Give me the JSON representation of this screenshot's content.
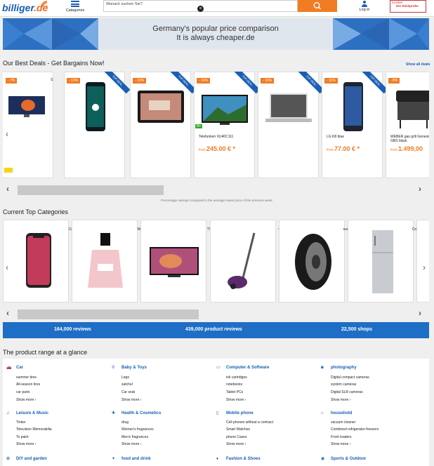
{
  "header": {
    "logo_main": "billiger",
    "logo_tld": ".de",
    "categories_label": "Categories",
    "search_placeholder": "Wonach suchen Sie?",
    "login_label": "Log in",
    "badge_top": "Kunden",
    "badge_main": "Die Stichprobe"
  },
  "banner": {
    "line1": "Germany's popular price comparison",
    "line2": "It is always cheaper.de"
  },
  "deals": {
    "title": "Our Best Deals - Get Bargains Now!",
    "show_all": "Show all deals",
    "ribbon": "TOP DEAL",
    "note": "Percentage savings compared to the average lowest price of the previous week.",
    "items": [
      {
        "discount": "- 7%",
        "name": "",
        "from": "",
        "price": ""
      },
      {
        "discount": "- 13%",
        "name": "",
        "from": "",
        "price": ""
      },
      {
        "discount": "- 13%",
        "name": "",
        "from": "",
        "price": ""
      },
      {
        "discount": "- 14%",
        "name": "Telefunken XU40C111",
        "from": "from",
        "price": "245.00 € *"
      },
      {
        "discount": "- 10%",
        "name": "",
        "from": "",
        "price": ""
      },
      {
        "discount": "- 11%",
        "name": "LG K8 blue",
        "from": "from",
        "price": "77.00 € *"
      },
      {
        "discount": "- 8%",
        "name": "WEBER gas grill Genesis II E-410 GBS black",
        "from": "from",
        "price": "1.499,00"
      }
    ],
    "rating": "A+",
    "side_letters": [
      "S",
      "u"
    ]
  },
  "categories": {
    "title": "Current Top Categories",
    "labels": [
      "Cel",
      "Wo",
      "TV",
      "vac",
      "sum",
      "Con"
    ]
  },
  "stats": {
    "reviews": "164,000 reviews",
    "product_reviews": "439,000 product reviews",
    "shops": "22,500 shops"
  },
  "range": {
    "title": "The product range at a glance",
    "groups": [
      {
        "title": "Car",
        "icon": "car-icon",
        "items": [
          "summer tires",
          "All-season tires",
          "car parts"
        ],
        "more": "Show more"
      },
      {
        "title": "Baby & Toys",
        "icon": "baby-icon",
        "items": [
          "Lego",
          "satchel",
          "Car seat"
        ],
        "more": "Show more"
      },
      {
        "title": "Computer & Software",
        "icon": "computer-icon",
        "items": [
          "ink cartridges",
          "notebooks",
          "Tablet PCs"
        ],
        "more": "Show more"
      },
      {
        "title": "photography",
        "icon": "camera-icon",
        "items": [
          "Digital compact cameras",
          "system cameras",
          "Digital SLR cameras"
        ],
        "more": "Show more"
      },
      {
        "title": "Leisure & Music",
        "icon": "music-icon",
        "items": [
          "Tinker",
          "Television Memorabilia",
          "To paint"
        ],
        "more": "Show more"
      },
      {
        "title": "Health & Cosmetics",
        "icon": "health-icon",
        "items": [
          "drug",
          "Women's fragrances",
          "Men's fragrances"
        ],
        "more": "Show more"
      },
      {
        "title": "Mobile phone",
        "icon": "phone-icon",
        "items": [
          "Cell phones without a contract",
          "Smart Watches",
          "phone Cases"
        ],
        "more": "Show more"
      },
      {
        "title": "household",
        "icon": "household-icon",
        "items": [
          "vacuum cleaner",
          "Combined refrigerator-freezers",
          "Front loaders"
        ],
        "more": "Show more"
      },
      {
        "title": "DIY and garden",
        "icon": "garden-icon",
        "items": [],
        "more": ""
      },
      {
        "title": "food and drink",
        "icon": "food-icon",
        "items": [],
        "more": ""
      },
      {
        "title": "Fashion & Shoes",
        "icon": "fashion-icon",
        "items": [],
        "more": ""
      },
      {
        "title": "Sports & Outdoor",
        "icon": "sports-icon",
        "items": [],
        "more": ""
      }
    ]
  },
  "colors": {
    "brand_blue": "#1a5fb4",
    "accent_orange": "#f07c23",
    "stats_blue": "#1e6ec6"
  }
}
